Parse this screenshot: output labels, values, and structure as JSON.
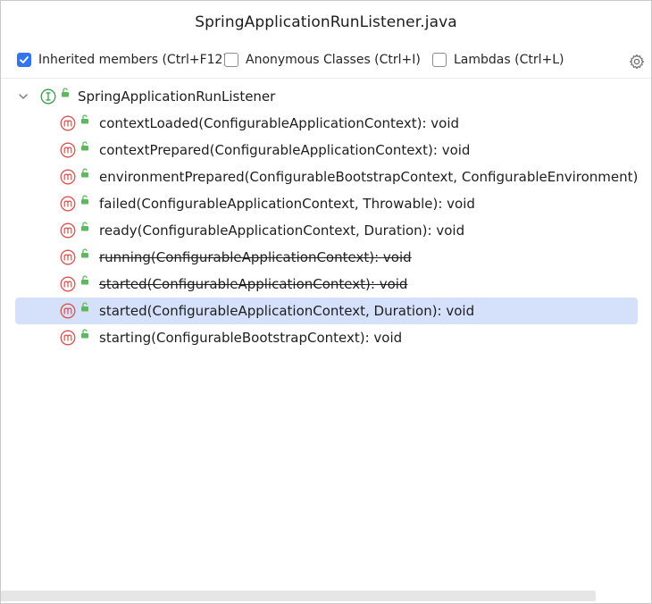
{
  "window": {
    "title": "SpringApplicationRunListener.java"
  },
  "toolbar": {
    "inherited": {
      "label": "Inherited members (Ctrl+F12)",
      "checked": true
    },
    "anonymous": {
      "label": "Anonymous Classes (Ctrl+I)",
      "checked": false
    },
    "lambdas": {
      "label": "Lambdas (Ctrl+L)",
      "checked": false
    },
    "settings_icon": "gear-icon"
  },
  "tree": {
    "root": {
      "label": "SpringApplicationRunListener",
      "icon": "interface-icon"
    },
    "members": [
      {
        "label": "contextLoaded(ConfigurableApplicationContext): void",
        "deprecated": false,
        "selected": false
      },
      {
        "label": "contextPrepared(ConfigurableApplicationContext): void",
        "deprecated": false,
        "selected": false
      },
      {
        "label": "environmentPrepared(ConfigurableBootstrapContext, ConfigurableEnvironment)",
        "deprecated": false,
        "selected": false
      },
      {
        "label": "failed(ConfigurableApplicationContext, Throwable): void",
        "deprecated": false,
        "selected": false
      },
      {
        "label": "ready(ConfigurableApplicationContext, Duration): void",
        "deprecated": false,
        "selected": false
      },
      {
        "label": "running(ConfigurableApplicationContext): void",
        "deprecated": true,
        "selected": false
      },
      {
        "label": "started(ConfigurableApplicationContext): void",
        "deprecated": true,
        "selected": false
      },
      {
        "label": "started(ConfigurableApplicationContext, Duration): void",
        "deprecated": false,
        "selected": true
      },
      {
        "label": "starting(ConfigurableBootstrapContext): void",
        "deprecated": false,
        "selected": false
      }
    ]
  },
  "colors": {
    "accent": "#3574f0",
    "selection": "#d5e1fb",
    "method_icon": "#d9534f",
    "interface_icon": "#3c9a4b",
    "lock_icon": "#5fb85f"
  }
}
